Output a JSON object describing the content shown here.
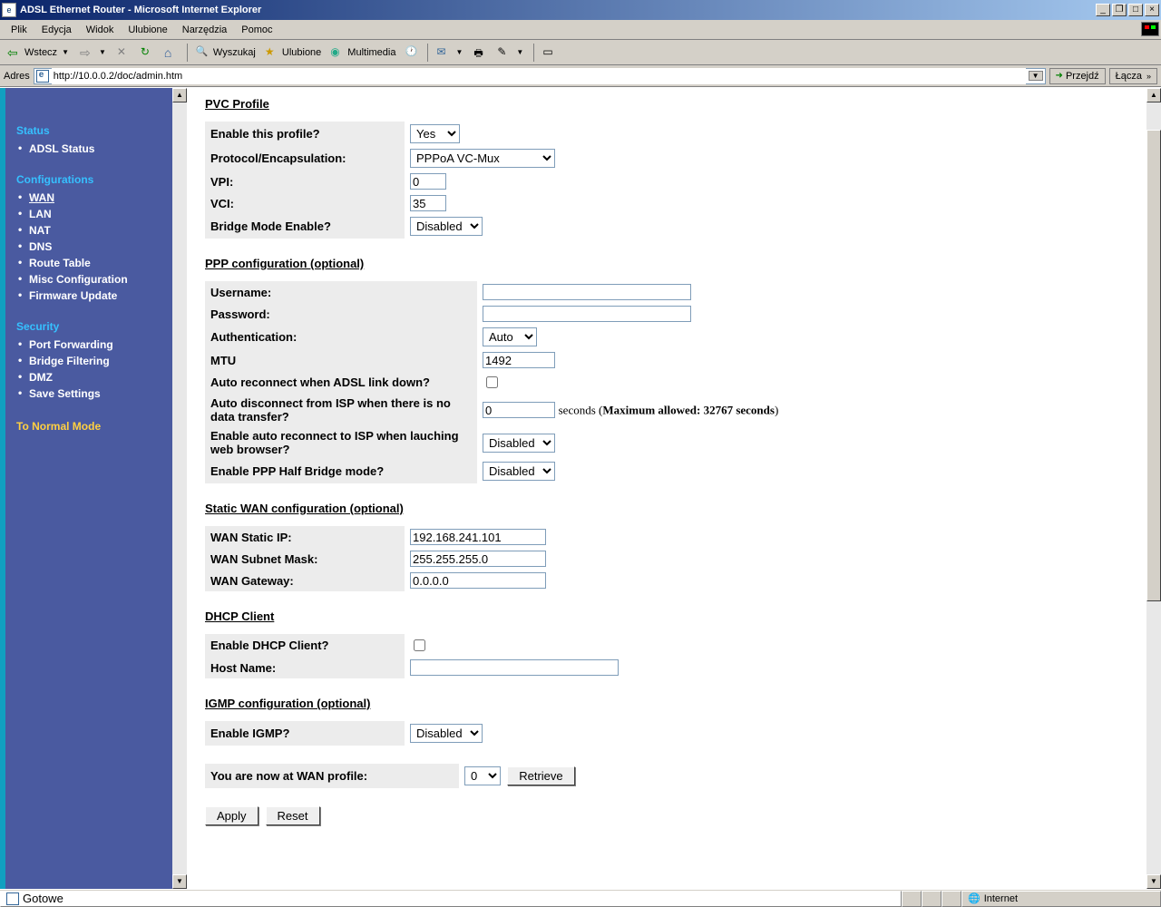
{
  "window": {
    "title": "ADSL Ethernet Router - Microsoft Internet Explorer"
  },
  "menu": {
    "items": [
      "Plik",
      "Edycja",
      "Widok",
      "Ulubione",
      "Narzędzia",
      "Pomoc"
    ]
  },
  "toolbar": {
    "back": "Wstecz",
    "search": "Wyszukaj",
    "favorites": "Ulubione",
    "media": "Multimedia"
  },
  "address": {
    "label": "Adres",
    "url": "http://10.0.0.2/doc/admin.htm",
    "go": "Przejdź",
    "links": "Łącza"
  },
  "sidebar": {
    "status_head": "Status",
    "status_items": [
      "ADSL Status"
    ],
    "config_head": "Configurations",
    "config_items": [
      "WAN",
      "LAN",
      "NAT",
      "DNS",
      "Route Table",
      "Misc Configuration",
      "Firmware Update"
    ],
    "security_head": "Security",
    "security_items": [
      "Port Forwarding",
      "Bridge Filtering",
      "DMZ",
      "Save Settings"
    ],
    "normal_mode": "To Normal Mode"
  },
  "pvc": {
    "title": "PVC Profile",
    "enable_label": "Enable this profile?",
    "enable_value": "Yes",
    "proto_label": "Protocol/Encapsulation:",
    "proto_value": "PPPoA VC-Mux",
    "vpi_label": "VPI:",
    "vpi_value": "0",
    "vci_label": "VCI:",
    "vci_value": "35",
    "bridge_label": "Bridge Mode Enable?",
    "bridge_value": "Disabled"
  },
  "ppp": {
    "title": "PPP configuration (optional)",
    "user_label": "Username:",
    "user_value": "",
    "pass_label": "Password:",
    "pass_value": "",
    "auth_label": "Authentication:",
    "auth_value": "Auto",
    "mtu_label": "MTU",
    "mtu_value": "1492",
    "autoreconn_label": "Auto reconnect when ADSL link down?",
    "autoreconn_checked": false,
    "autodisc_label": "Auto disconnect from ISP when there is no data transfer?",
    "autodisc_value": "0",
    "autodisc_hint": " seconds (Maximum allowed: 32767 seconds)",
    "autoreconn_browser_label": "Enable auto reconnect to ISP when lauching web browser?",
    "autoreconn_browser_value": "Disabled",
    "halfbridge_label": "Enable PPP Half Bridge mode?",
    "halfbridge_value": "Disabled"
  },
  "static": {
    "title": "Static WAN configuration (optional)",
    "ip_label": "WAN Static IP:",
    "ip_value": "192.168.241.101",
    "mask_label": "WAN Subnet Mask:",
    "mask_value": "255.255.255.0",
    "gw_label": "WAN Gateway:",
    "gw_value": "0.0.0.0"
  },
  "dhcp": {
    "title": "DHCP Client",
    "enable_label": "Enable DHCP Client?",
    "enable_checked": false,
    "host_label": "Host Name:",
    "host_value": ""
  },
  "igmp": {
    "title": "IGMP configuration (optional)",
    "enable_label": "Enable IGMP?",
    "enable_value": "Disabled"
  },
  "profile_row": {
    "label": "You are now at WAN profile:",
    "value": "0",
    "retrieve": "Retrieve"
  },
  "buttons": {
    "apply": "Apply",
    "reset": "Reset"
  },
  "status": {
    "ready": "Gotowe",
    "zone": "Internet"
  }
}
